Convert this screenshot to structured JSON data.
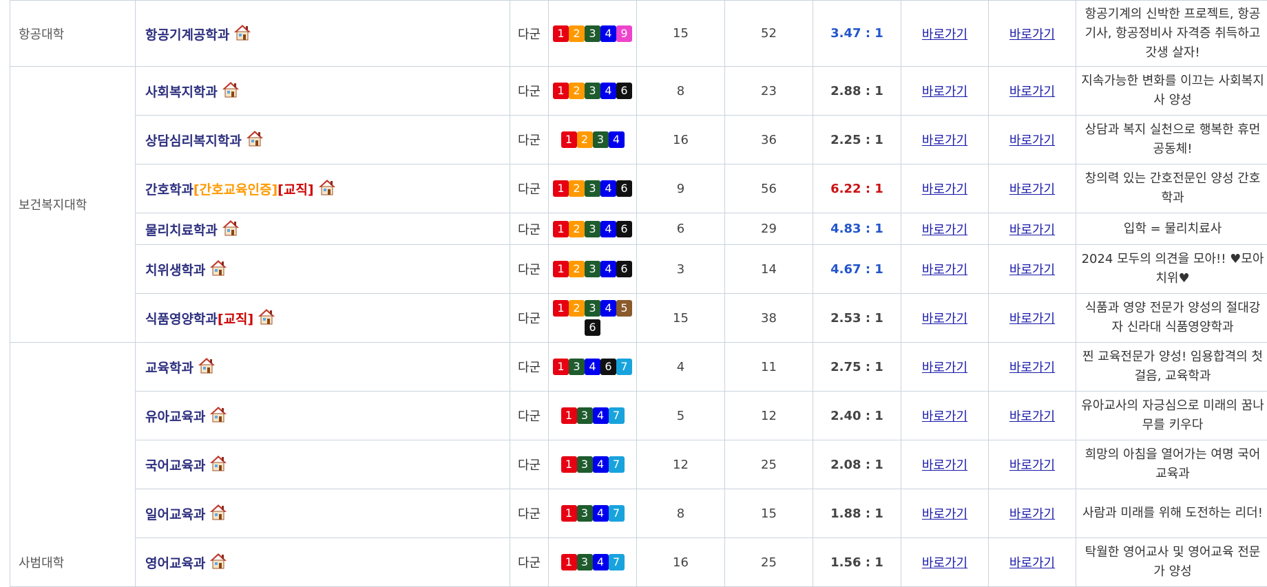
{
  "colors": {
    "b1": "#e60012",
    "b2": "#ff9900",
    "b3": "#1e5b2d",
    "b4": "#0000ee",
    "b5": "#8b5a2b",
    "b6": "#111111",
    "b7": "#19a3dc",
    "b9": "#ee44cc",
    "ratio_dark": "#444444",
    "ratio_blue": "#2255cc",
    "ratio_red": "#cc1111"
  },
  "rows": [
    {
      "college": "항공대학",
      "dept": "항공기계공학과",
      "tag1": "",
      "tag2": "",
      "group": "다군",
      "badges": [
        "1",
        "2",
        "3",
        "4",
        "9"
      ],
      "n1": "15",
      "n2": "52",
      "ratio": "3.47 : 1",
      "ratio_color": "#2255cc",
      "link1": "바로가기",
      "link2": "바로가기",
      "desc": "항공기계의 신박한 프로젝트, 항공기사, 항공정비사 자격증 취득하고 갓생 살자!"
    },
    {
      "college": "보건복지대학",
      "dept": "사회복지학과",
      "tag1": "",
      "tag2": "",
      "group": "다군",
      "badges": [
        "1",
        "2",
        "3",
        "4",
        "6"
      ],
      "n1": "8",
      "n2": "23",
      "ratio": "2.88 : 1",
      "ratio_color": "#444444",
      "link1": "바로가기",
      "link2": "바로가기",
      "desc": "지속가능한 변화를 이끄는 사회복지사 양성"
    },
    {
      "college": "",
      "dept": "상담심리복지학과",
      "tag1": "",
      "tag2": "",
      "group": "다군",
      "badges": [
        "1",
        "2",
        "3",
        "4"
      ],
      "n1": "16",
      "n2": "36",
      "ratio": "2.25 : 1",
      "ratio_color": "#444444",
      "link1": "바로가기",
      "link2": "바로가기",
      "desc": "상담과 복지 실천으로 행복한 휴먼공동체!"
    },
    {
      "college": "",
      "dept": "간호학과",
      "tag1": "[간호교육인증]",
      "tag2": "[교직]",
      "group": "다군",
      "badges": [
        "1",
        "2",
        "3",
        "4",
        "6"
      ],
      "n1": "9",
      "n2": "56",
      "ratio": "6.22 : 1",
      "ratio_color": "#cc1111",
      "link1": "바로가기",
      "link2": "바로가기",
      "desc": "창의력 있는 간호전문인 양성 간호학과"
    },
    {
      "college": "",
      "dept": "물리치료학과",
      "tag1": "",
      "tag2": "",
      "group": "다군",
      "badges": [
        "1",
        "2",
        "3",
        "4",
        "6"
      ],
      "n1": "6",
      "n2": "29",
      "ratio": "4.83 : 1",
      "ratio_color": "#2255cc",
      "link1": "바로가기",
      "link2": "바로가기",
      "desc": "입학 = 물리치료사"
    },
    {
      "college": "",
      "dept": "치위생학과",
      "tag1": "",
      "tag2": "",
      "group": "다군",
      "badges": [
        "1",
        "2",
        "3",
        "4",
        "6"
      ],
      "n1": "3",
      "n2": "14",
      "ratio": "4.67 : 1",
      "ratio_color": "#2255cc",
      "link1": "바로가기",
      "link2": "바로가기",
      "desc": "2024 모두의 의견을 모아!! ♥모아치위♥"
    },
    {
      "college": "",
      "dept": "식품영양학과",
      "tag1": "",
      "tag2": "[교직]",
      "group": "다군",
      "badges": [
        "1",
        "2",
        "3",
        "4",
        "5",
        "6"
      ],
      "n1": "15",
      "n2": "38",
      "ratio": "2.53 : 1",
      "ratio_color": "#444444",
      "link1": "바로가기",
      "link2": "바로가기",
      "desc": "식품과 영양 전문가 양성의 절대강자 신라대 식품영양학과"
    },
    {
      "college": "사범대학",
      "dept": "교육학과",
      "tag1": "",
      "tag2": "",
      "group": "다군",
      "badges": [
        "1",
        "3",
        "4",
        "6",
        "7"
      ],
      "n1": "4",
      "n2": "11",
      "ratio": "2.75 : 1",
      "ratio_color": "#444444",
      "link1": "바로가기",
      "link2": "바로가기",
      "desc": "찐 교육전문가 양성! 임용합격의 첫 걸음, 교육학과"
    },
    {
      "college": "",
      "dept": "유아교육과",
      "tag1": "",
      "tag2": "",
      "group": "다군",
      "badges": [
        "1",
        "3",
        "4",
        "7"
      ],
      "n1": "5",
      "n2": "12",
      "ratio": "2.40 : 1",
      "ratio_color": "#444444",
      "link1": "바로가기",
      "link2": "바로가기",
      "desc": "유아교사의 자긍심으로 미래의 꿈나무를 키우다"
    },
    {
      "college": "",
      "dept": "국어교육과",
      "tag1": "",
      "tag2": "",
      "group": "다군",
      "badges": [
        "1",
        "3",
        "4",
        "7"
      ],
      "n1": "12",
      "n2": "25",
      "ratio": "2.08 : 1",
      "ratio_color": "#444444",
      "link1": "바로가기",
      "link2": "바로가기",
      "desc": "희망의 아침을 열어가는 여명 국어교육과"
    },
    {
      "college": "",
      "dept": "일어교육과",
      "tag1": "",
      "tag2": "",
      "group": "다군",
      "badges": [
        "1",
        "3",
        "4",
        "7"
      ],
      "n1": "8",
      "n2": "15",
      "ratio": "1.88 : 1",
      "ratio_color": "#444444",
      "link1": "바로가기",
      "link2": "바로가기",
      "desc": "사람과 미래를 위해 도전하는 리더!"
    },
    {
      "college": "",
      "dept": "영어교육과",
      "tag1": "",
      "tag2": "",
      "group": "다군",
      "badges": [
        "1",
        "3",
        "4",
        "7"
      ],
      "n1": "16",
      "n2": "25",
      "ratio": "1.56 : 1",
      "ratio_color": "#444444",
      "link1": "바로가기",
      "link2": "바로가기",
      "desc": "탁월한 영어교사 및 영어교육 전문가 양성"
    }
  ]
}
